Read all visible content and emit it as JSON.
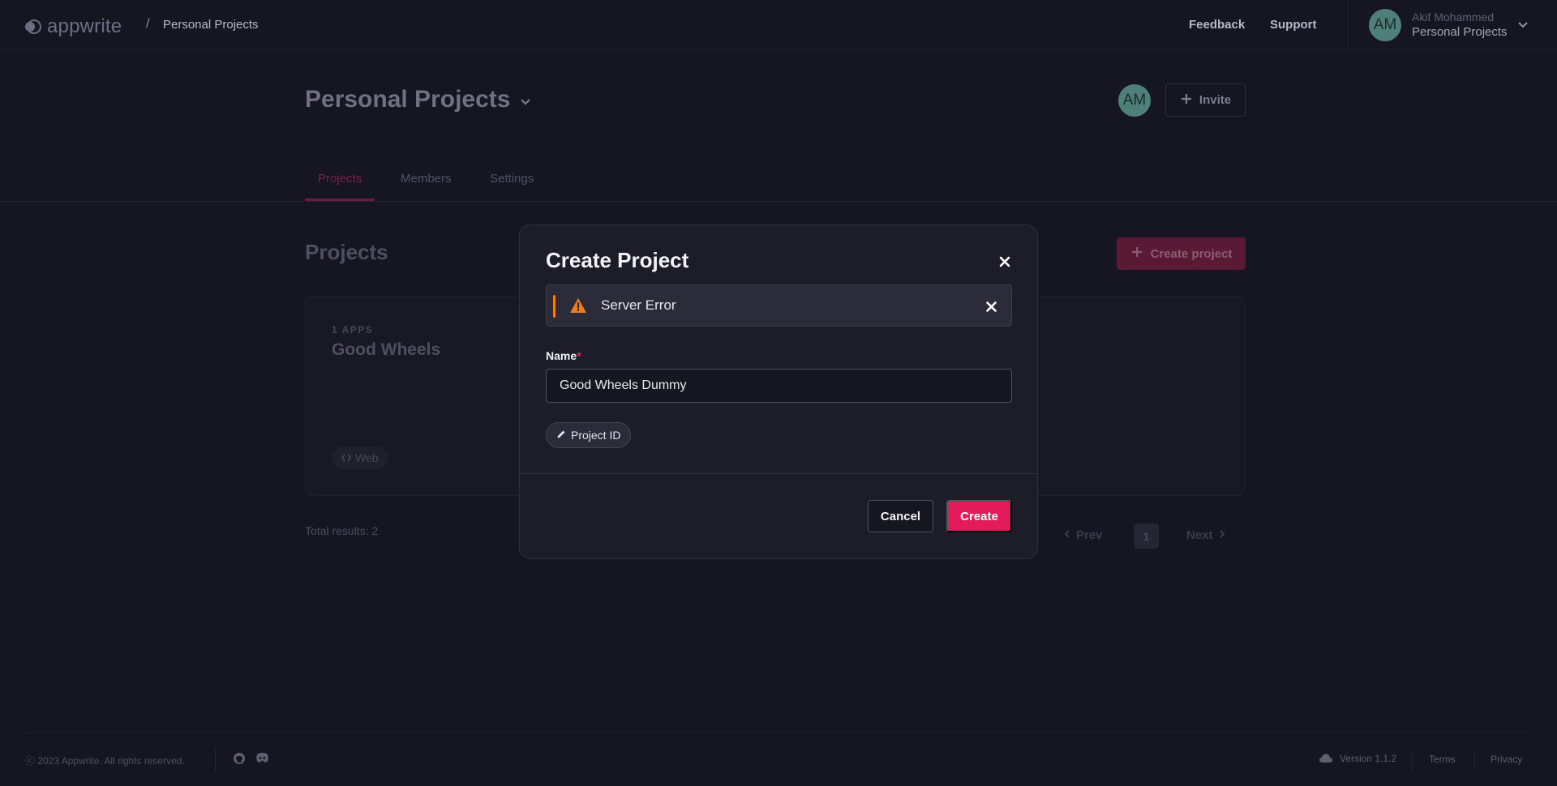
{
  "header": {
    "logo_text": "appwrite",
    "breadcrumb_separator": "/",
    "breadcrumb": "Personal Projects",
    "links": {
      "feedback": "Feedback",
      "support": "Support"
    },
    "user": {
      "initials": "AM",
      "name": "Akif Mohammed",
      "organization": "Personal Projects"
    }
  },
  "organization": {
    "title": "Personal Projects",
    "avatar_initials": "AM",
    "invite_label": "Invite"
  },
  "tabs": [
    {
      "label": "Projects",
      "active": true
    },
    {
      "label": "Members",
      "active": false
    },
    {
      "label": "Settings",
      "active": false
    }
  ],
  "projects": {
    "title": "Projects",
    "create_label": "Create project",
    "cards": [
      {
        "apps_count": "1 APPS",
        "name": "Good Wheels",
        "platform": "Web"
      }
    ],
    "total_results": "Total results: 2",
    "pagination": {
      "prev": "Prev",
      "current": "1",
      "next": "Next"
    }
  },
  "footer": {
    "copyright": "ⓒ 2023 Appwrite. All rights reserved.",
    "version": "Version 1.1.2",
    "terms": "Terms",
    "privacy": "Privacy"
  },
  "modal": {
    "title": "Create Project",
    "alert_message": "Server Error",
    "name_label": "Name",
    "required_marker": "*",
    "name_value": "Good Wheels Dummy",
    "project_id_label": "Project ID",
    "cancel_label": "Cancel",
    "create_label": "Create"
  },
  "colors": {
    "background": "#161622",
    "primary": "#e31b5c",
    "warning": "#f07e1c",
    "avatar": "#4e7f79"
  },
  "icons": {
    "logo": "appwrite-logo-icon",
    "user_menu": "chevron-down-icon",
    "invite": "plus-icon",
    "close": "close-icon",
    "alert": "warning-triangle-icon",
    "edit": "pencil-icon",
    "platform": "code-icon",
    "prev": "chevron-left-icon",
    "next": "chevron-right-icon",
    "github": "github-icon",
    "discord": "discord-icon",
    "cloud": "cloud-icon"
  }
}
